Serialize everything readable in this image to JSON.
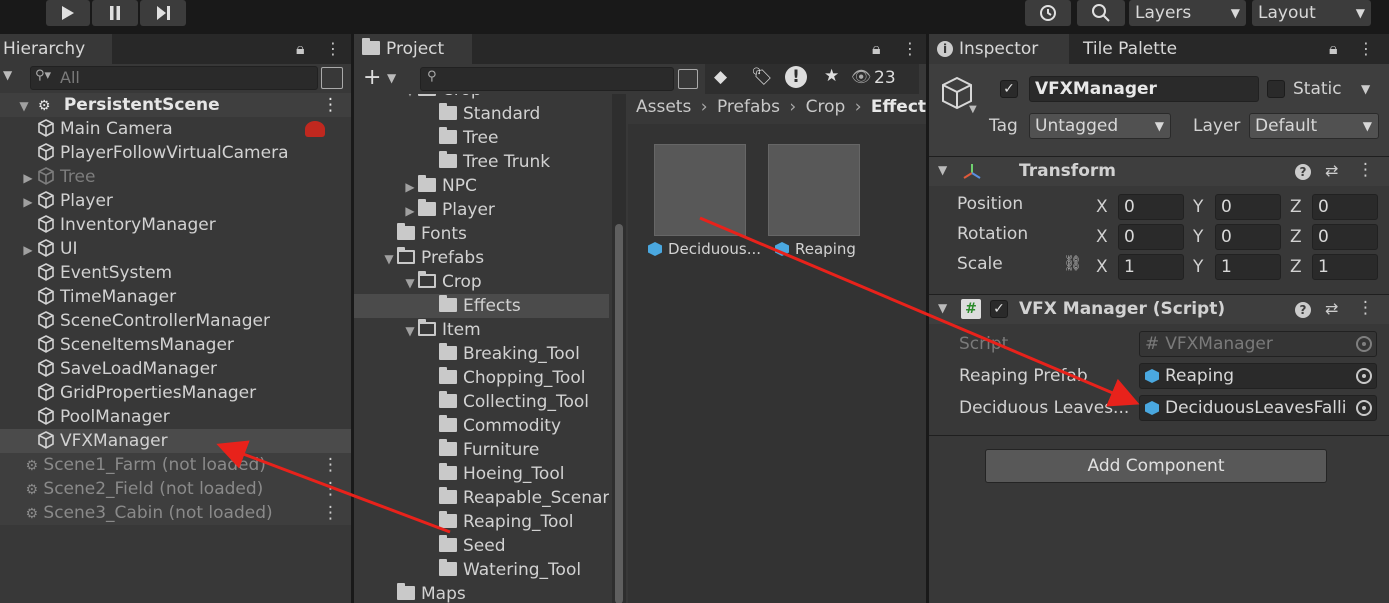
{
  "toolbar": {
    "layers_label": "Layers",
    "layout_label": "Layout"
  },
  "hierarchy": {
    "tab_label": "Hierarchy",
    "search_placeholder": "All",
    "scene_name": "PersistentScene",
    "items": [
      {
        "label": "Main Camera"
      },
      {
        "label": "PlayerFollowVirtualCamera"
      },
      {
        "label": "Tree"
      },
      {
        "label": "Player"
      },
      {
        "label": "InventoryManager"
      },
      {
        "label": "UI"
      },
      {
        "label": "EventSystem"
      },
      {
        "label": "TimeManager"
      },
      {
        "label": "SceneControllerManager"
      },
      {
        "label": "SceneItemsManager"
      },
      {
        "label": "SaveLoadManager"
      },
      {
        "label": "GridPropertiesManager"
      },
      {
        "label": "PoolManager"
      },
      {
        "label": "VFXManager"
      }
    ],
    "unloaded_scenes": [
      {
        "label": "Scene1_Farm (not loaded)"
      },
      {
        "label": "Scene2_Field (not loaded)"
      },
      {
        "label": "Scene3_Cabin (not loaded)"
      }
    ]
  },
  "project": {
    "tab_label": "Project",
    "hidden_count": "23",
    "tree": [
      {
        "label": "Crop"
      },
      {
        "label": "Standard"
      },
      {
        "label": "Tree"
      },
      {
        "label": "Tree Trunk"
      },
      {
        "label": "NPC"
      },
      {
        "label": "Player"
      },
      {
        "label": "Fonts"
      },
      {
        "label": "Prefabs"
      },
      {
        "label": "Crop"
      },
      {
        "label": "Effects"
      },
      {
        "label": "Item"
      },
      {
        "label": "Breaking_Tool"
      },
      {
        "label": "Chopping_Tool"
      },
      {
        "label": "Collecting_Tool"
      },
      {
        "label": "Commodity"
      },
      {
        "label": "Furniture"
      },
      {
        "label": "Hoeing_Tool"
      },
      {
        "label": "Reapable_Scenary"
      },
      {
        "label": "Reaping_Tool"
      },
      {
        "label": "Seed"
      },
      {
        "label": "Watering_Tool"
      },
      {
        "label": "Maps"
      }
    ],
    "breadcrumb": [
      {
        "label": "Assets"
      },
      {
        "label": "Prefabs"
      },
      {
        "label": "Crop"
      },
      {
        "label": "Effects"
      }
    ],
    "assets": [
      {
        "label": "Deciduous..."
      },
      {
        "label": "Reaping"
      }
    ]
  },
  "inspector": {
    "tab_label": "Inspector",
    "tab2_label": "Tile Palette",
    "object_name": "VFXManager",
    "static_label": "Static",
    "tag_label": "Tag",
    "tag_value": "Untagged",
    "layer_label": "Layer",
    "layer_value": "Default",
    "transform": {
      "title": "Transform",
      "position_label": "Position",
      "rotation_label": "Rotation",
      "scale_label": "Scale",
      "x": "X",
      "y": "Y",
      "z": "Z",
      "position": [
        "0",
        "0",
        "0"
      ],
      "rotation": [
        "0",
        "0",
        "0"
      ],
      "scale": [
        "1",
        "1",
        "1"
      ]
    },
    "script_component": {
      "title": "VFX Manager (Script)",
      "script_label": "Script",
      "script_value": "VFXManager",
      "reaping_label": "Reaping Prefab",
      "reaping_value": "Reaping",
      "deciduous_label": "Deciduous Leaves...",
      "deciduous_value": "DeciduousLeavesFalli"
    },
    "add_component_label": "Add Component"
  },
  "colors": {
    "annotation_arrow": "#e8221b",
    "prefab_icon": "#4aa8e0"
  }
}
